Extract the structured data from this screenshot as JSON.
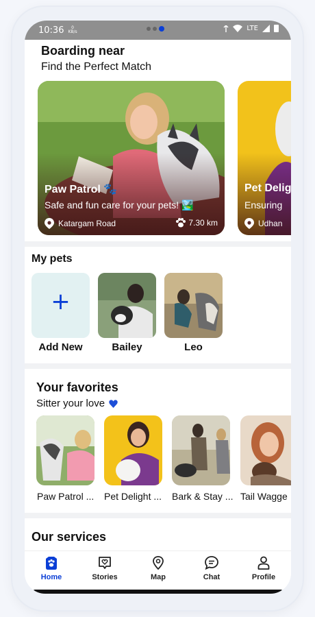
{
  "status": {
    "time": "10:36",
    "kb_top": "0",
    "kb_bottom": "KB/s",
    "network": "LTE"
  },
  "boarding": {
    "title": "Boarding near",
    "subtitle": "Find the Perfect Match",
    "cards": [
      {
        "name": "Paw Patrol 🐾",
        "desc": "Safe and fun care for your pets! 🏞️",
        "location": "Katargam Road",
        "distance": "7.30 km"
      },
      {
        "name": "Pet Delig",
        "desc": "Ensuring",
        "location": "Udhan"
      }
    ]
  },
  "my_pets": {
    "title": "My pets",
    "add_label": "Add New",
    "add_symbol": "+",
    "pets": [
      {
        "name": "Bailey"
      },
      {
        "name": "Leo"
      }
    ]
  },
  "favorites": {
    "title": "Your favorites",
    "subtitle": "Sitter your love",
    "items": [
      {
        "label": "Paw Patrol ..."
      },
      {
        "label": "Pet Delight ..."
      },
      {
        "label": "Bark & Stay ..."
      },
      {
        "label": "Tail Wagge"
      }
    ]
  },
  "services": {
    "title": "Our services"
  },
  "nav": {
    "items": [
      {
        "label": "Home",
        "icon": "paw-icon"
      },
      {
        "label": "Stories",
        "icon": "heart-badge-icon"
      },
      {
        "label": "Map",
        "icon": "map-pin-icon"
      },
      {
        "label": "Chat",
        "icon": "chat-icon"
      },
      {
        "label": "Profile",
        "icon": "person-icon"
      }
    ]
  },
  "colors": {
    "accent": "#0b3fd6",
    "add_tile_bg": "#e2f1f2",
    "heart": "#1d4fd8"
  }
}
